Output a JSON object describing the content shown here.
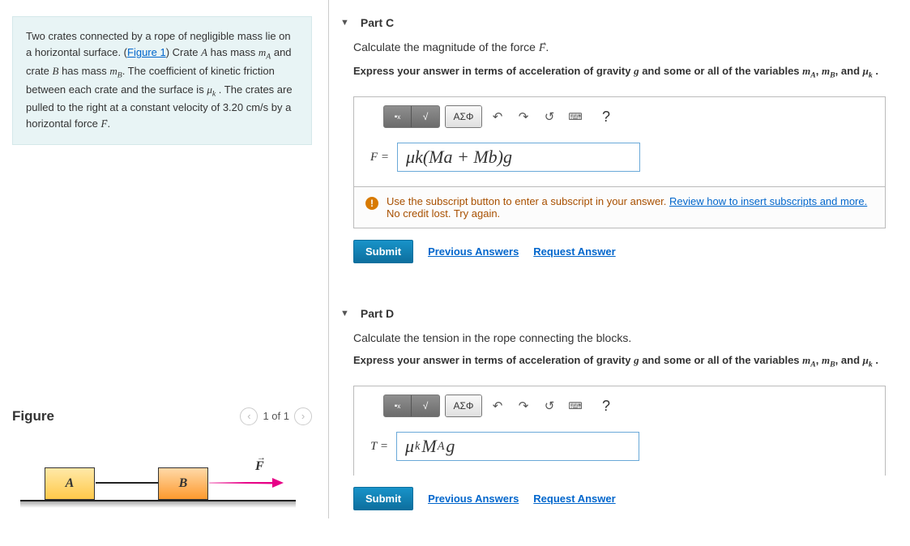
{
  "problem": {
    "text_1": "Two crates connected by a rope of negligible mass lie on a horizontal surface. (",
    "figure_link": "Figure 1",
    "text_2": ") Crate ",
    "var_A": "A",
    "text_3": " has mass ",
    "var_mA": "m",
    "sub_A": "A",
    "text_4": " and crate ",
    "var_B": "B",
    "text_5": " has mass ",
    "var_mB": "m",
    "sub_B": "B",
    "text_6": ". The coefficient of kinetic friction between each crate and the surface is ",
    "var_muk": "μ",
    "sub_k": "k",
    "text_7": " . The crates are pulled to the right at a constant velocity of ",
    "velocity": "3.20 cm/s",
    "text_8": " by a horizontal force ",
    "var_F": "F",
    "text_9": "."
  },
  "figure": {
    "title": "Figure",
    "page": "1 of 1",
    "label_A": "A",
    "label_B": "B",
    "force_label": "F"
  },
  "part_c": {
    "header": "Part C",
    "prompt_1": "Calculate the magnitude of the force ",
    "prompt_F": "F",
    "prompt_2": ".",
    "hint_prefix": "Express your answer in terms of acceleration of gravity ",
    "hint_g": "g",
    "hint_mid": " and some or all of the variables ",
    "hint_mA": "m",
    "hint_subA": "A",
    "hint_comma": ", ",
    "hint_mB": "m",
    "hint_subB": "B",
    "hint_and": ", and ",
    "hint_mu": "μ",
    "hint_subk": "k",
    "hint_end": " .",
    "toolbar_greek": "ΑΣΦ",
    "eq_label": "F = ",
    "answer": "μk(Ma + Mb)g",
    "feedback_1": "Use the subscript button to enter a subscript in your answer. ",
    "feedback_link": "Review how to insert subscripts and more.",
    "feedback_2": "No credit lost. Try again.",
    "submit": "Submit",
    "prev": "Previous Answers",
    "request": "Request Answer"
  },
  "part_d": {
    "header": "Part D",
    "prompt": "Calculate the tension in the rope connecting the blocks.",
    "hint_prefix": "Express your answer in terms of acceleration of gravity ",
    "hint_g": "g",
    "hint_mid": " and some or all of the variables ",
    "hint_mA": "m",
    "hint_subA": "A",
    "hint_comma": ", ",
    "hint_mB": "m",
    "hint_subB": "B",
    "hint_and": ", and ",
    "hint_mu": "μ",
    "hint_subk": "k",
    "hint_end": " .",
    "toolbar_greek": "ΑΣΦ",
    "eq_label": "T = ",
    "answer_mu": "μ",
    "answer_sub_k": "k",
    "answer_M": "M",
    "answer_sub_A": "A",
    "answer_g": "g",
    "submit": "Submit",
    "prev": "Previous Answers",
    "request": "Request Answer"
  },
  "icons": {
    "undo": "↶",
    "redo": "↷",
    "reset": "↺",
    "help": "?",
    "keyboard": "⌨"
  }
}
